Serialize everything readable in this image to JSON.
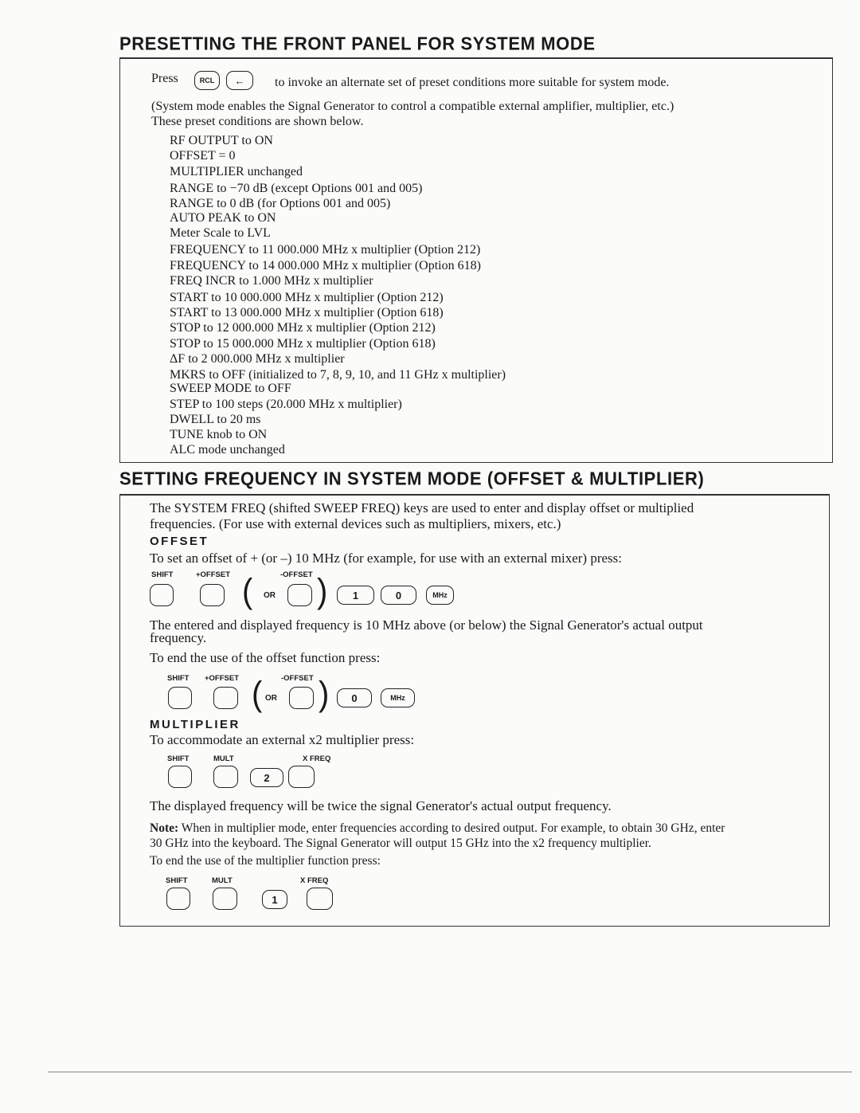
{
  "section1": {
    "title": "PRESETTING THE FRONT PANEL FOR SYSTEM MODE",
    "press_label": "Press",
    "keys": [
      "RCL",
      "←"
    ],
    "press_text": "to invoke an alternate set of preset conditions more suitable for system mode.",
    "note": "(System mode enables the Signal Generator to control a compatible external amplifier, multiplier, etc.)",
    "intro": "These preset conditions are shown below.",
    "items": [
      "RF OUTPUT to ON",
      "OFFSET = 0",
      "MULTIPLIER unchanged",
      "RANGE to −70 dB (except Options 001 and 005)",
      "RANGE to 0 dB (for Options 001 and 005)",
      "AUTO PEAK to ON",
      "Meter Scale to LVL",
      "FREQUENCY to 11 000.000 MHz x multiplier (Option 212)",
      "FREQUENCY to 14 000.000 MHz x multiplier (Option 618)",
      "FREQ INCR to 1.000 MHz x multiplier",
      "START to 10 000.000 MHz x multiplier (Option 212)",
      "START to 13 000.000 MHz x multiplier (Option 618)",
      "STOP to 12 000.000 MHz x multiplier (Option 212)",
      "STOP to 15 000.000 MHz x multiplier (Option 618)",
      "ΔF to 2 000.000 MHz x multiplier",
      "MKRS to OFF (initialized to 7, 8, 9, 10, and 11 GHz x multiplier)",
      "SWEEP MODE to OFF",
      "STEP to 100 steps (20.000 MHz x multiplier)",
      "DWELL to 20 ms",
      "TUNE knob to ON",
      "ALC mode unchanged"
    ]
  },
  "section2": {
    "title": "SETTING FREQUENCY IN SYSTEM MODE (OFFSET & MULTIPLIER)",
    "intro1": "The SYSTEM FREQ (shifted SWEEP FREQ) keys are used to enter and display offset or multiplied",
    "intro2": "frequencies. (For use with external devices such as multipliers, mixers, etc.)",
    "offset": {
      "heading": "OFFSET",
      "set_text": "To set an offset of + (or –) 10 MHz (for example, for use with an external mixer) press:",
      "labels": {
        "shift": "SHIFT",
        "plus": "+OFFSET",
        "minus": "-OFFSET",
        "or": "OR"
      },
      "set_keys": [
        "1",
        "0",
        "MHz"
      ],
      "result1": "The entered and displayed frequency is 10 MHz above (or below) the Signal Generator's actual output",
      "result2": "frequency.",
      "end_text": "To end the use of the offset function press:",
      "end_keys": [
        "0",
        "MHz"
      ]
    },
    "multiplier": {
      "heading": "MULTIPLIER",
      "set_text": "To accommodate an external x2 multiplier press:",
      "labels": {
        "shift": "SHIFT",
        "mult": "MULT",
        "xfreq": "X FREQ"
      },
      "set_keys": [
        "2"
      ],
      "result": "The displayed frequency will be twice the signal Generator's actual output frequency.",
      "note_label": "Note:",
      "note1": "When in multiplier mode, enter frequencies according to desired output. For example, to obtain 30 GHz, enter",
      "note2": "30 GHz into the keyboard. The Signal Generator will output 15 GHz into the x2 frequency multiplier.",
      "end_text": "To end the use of the multiplier function press:",
      "end_keys": [
        "1"
      ]
    }
  }
}
